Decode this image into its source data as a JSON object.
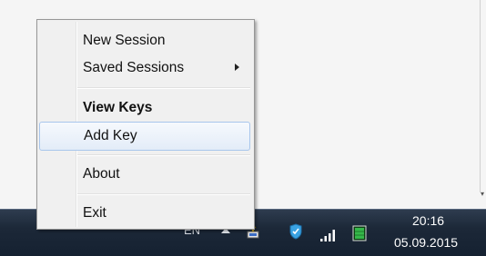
{
  "context_menu": {
    "items": [
      {
        "label": "New Session"
      },
      {
        "label": "Saved Sessions"
      },
      {
        "label": "View Keys"
      },
      {
        "label": "Add Key"
      },
      {
        "label": "About"
      },
      {
        "label": "Exit"
      }
    ]
  },
  "taskbar": {
    "language": "EN",
    "clock_time": "20:16",
    "clock_date": "05.09.2015",
    "icons": [
      "show-hidden-icons-arrow",
      "pageant-key-icon",
      "security-shield-icon",
      "network-signal-icon",
      "battery-icon"
    ]
  },
  "colors": {
    "taskbar": "#1c2838",
    "menu_bg": "#f0f0f0",
    "hover_border": "#a8c6ec"
  }
}
